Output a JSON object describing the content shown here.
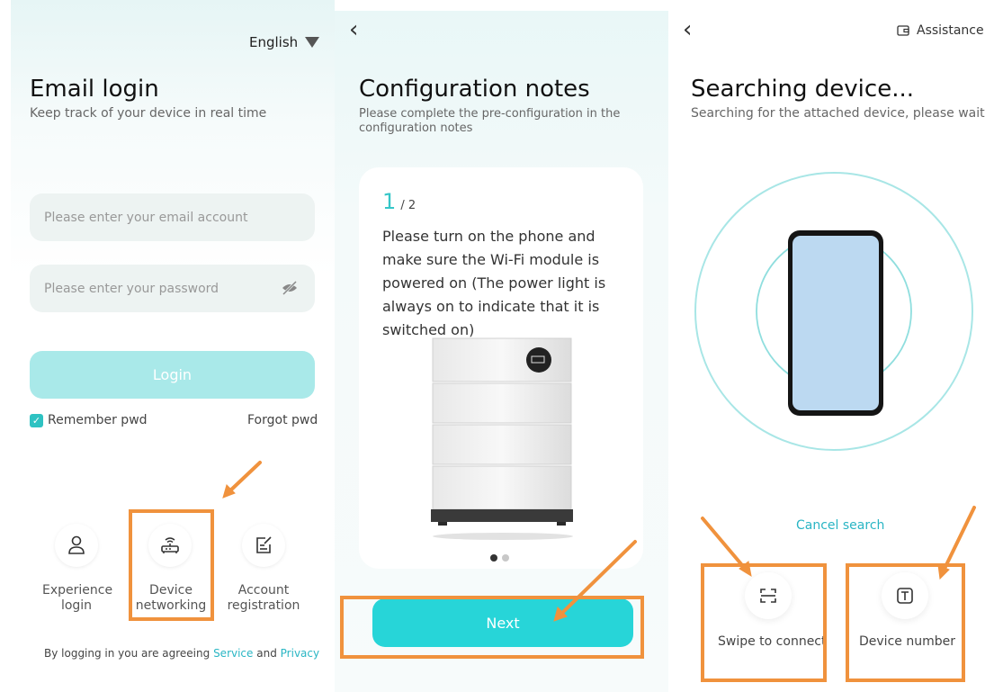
{
  "panel1": {
    "language": "English",
    "title": "Email login",
    "subtitle": "Keep track of your device in real time",
    "email_placeholder": "Please enter your email account",
    "password_placeholder": "Please enter your password",
    "login_label": "Login",
    "remember_label": "Remember pwd",
    "remember_checked": true,
    "forgot_label": "Forgot pwd",
    "options": [
      {
        "icon": "person-icon",
        "line1": "Experience",
        "line2": "login"
      },
      {
        "icon": "router-icon",
        "line1": "Device",
        "line2": "networking"
      },
      {
        "icon": "edit-icon",
        "line1": "Account",
        "line2": "registration"
      }
    ],
    "agree_text": "By logging in you are agreeing",
    "service_link": "Service",
    "and_text": "and",
    "privacy_link": "Privacy"
  },
  "panel2": {
    "title": "Configuration notes",
    "subtitle": "Please complete the pre-configuration in the configuration notes",
    "step_current": "1",
    "step_total": "/ 2",
    "instruction": "Please turn on the phone and make sure the Wi-Fi module is powered on (The power light is always on to indicate that it is switched on)",
    "next_label": "Next"
  },
  "panel3": {
    "assistance_label": "Assistance",
    "title": "Searching device...",
    "subtitle": "Searching for the attached device, please wait",
    "cancel_label": "Cancel search",
    "swipe_label": "Swipe to connect",
    "device_number_label": "Device number"
  },
  "colors": {
    "accent": "#27d5d8",
    "accent_light": "#a9e9e9",
    "link": "#29b5c4",
    "annotation": "#f0923d"
  }
}
